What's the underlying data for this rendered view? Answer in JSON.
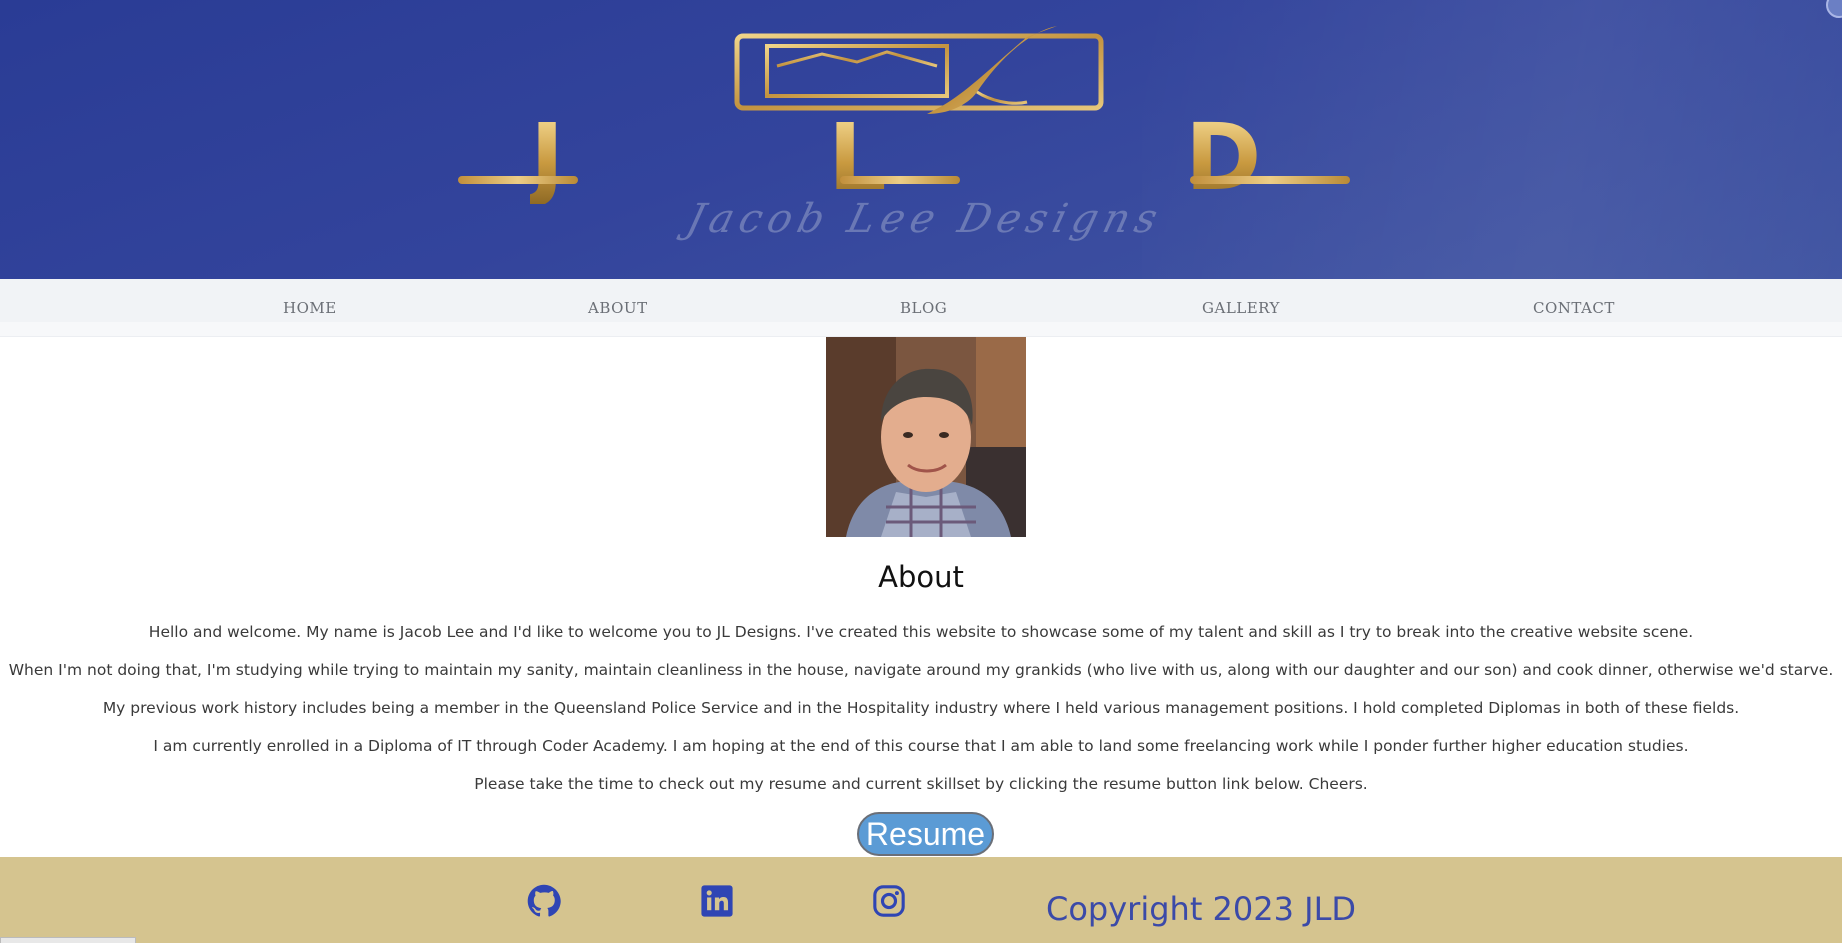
{
  "header": {
    "logo_letters": [
      "J",
      "L",
      "D"
    ],
    "logo_script": "Jacob Lee Designs"
  },
  "nav": {
    "items": [
      {
        "label": "HOME"
      },
      {
        "label": "ABOUT"
      },
      {
        "label": "BLOG"
      },
      {
        "label": "GALLERY"
      },
      {
        "label": "CONTACT"
      }
    ]
  },
  "main": {
    "title": "About",
    "paragraphs": [
      "Hello and welcome. My name is Jacob Lee and I'd like to welcome you to JL Designs. I've created this website to showcase some of my talent and skill as I try to break into the creative website scene.",
      "When I'm not doing that, I'm studying while trying to maintain my sanity, maintain cleanliness in the house, navigate around my grankids (who live with us, along with our daughter and our son) and cook dinner, otherwise we'd starve.",
      "My previous work history includes being a member in the Queensland Police Service and in the Hospitality industry where I held various management positions. I hold completed Diplomas in both of these fields.",
      "I am currently enrolled in a Diploma of IT through Coder Academy. I am hoping at the end of this course that I am able to land some freelancing work while I ponder further higher education studies.",
      "Please take the time to check out my resume and current skillset by clicking the resume button link below. Cheers."
    ],
    "resume_label": "Resume"
  },
  "footer": {
    "icons": [
      "github-icon",
      "linkedin-icon",
      "instagram-icon"
    ],
    "copyright": "Copyright 2023 JLD"
  },
  "colors": {
    "header_blue": "#33449c",
    "gold": "#c99a40",
    "footer_tan": "#d5c48f",
    "footer_text": "#3b4aa8",
    "button_blue": "#5b9bd5"
  }
}
